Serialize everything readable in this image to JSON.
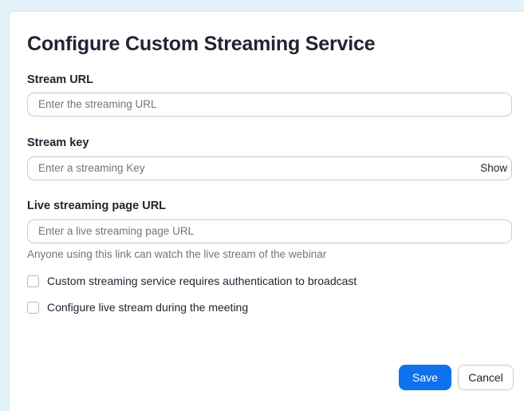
{
  "dialog": {
    "title": "Configure Custom Streaming Service",
    "stream_url": {
      "label": "Stream URL",
      "placeholder": "Enter the streaming URL",
      "value": ""
    },
    "stream_key": {
      "label": "Stream key",
      "placeholder": "Enter a streaming Key",
      "value": "",
      "show_label": "Show"
    },
    "page_url": {
      "label": "Live streaming page URL",
      "placeholder": "Enter a live streaming page URL",
      "value": "",
      "hint": "Anyone using this link can watch the live stream of the webinar"
    },
    "options": [
      {
        "label": "Custom streaming service requires authentication to broadcast",
        "checked": false
      },
      {
        "label": "Configure live stream during the meeting",
        "checked": false
      }
    ],
    "buttons": {
      "save": "Save",
      "cancel": "Cancel"
    }
  },
  "colors": {
    "accent": "#0e72ed",
    "background": "#e3f3f9",
    "text": "#232333",
    "muted_text": "#6e7680",
    "border": "#c9c9d1"
  }
}
